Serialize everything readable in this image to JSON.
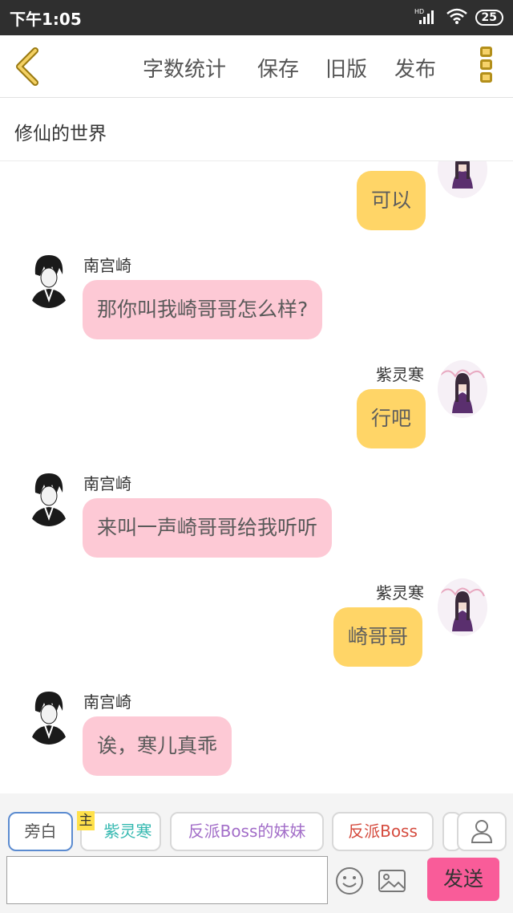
{
  "status_bar": {
    "time": "下午1:05",
    "network": "HD",
    "battery": "25"
  },
  "toolbar": {
    "back_icon": "chevron-left-icon",
    "menu": [
      "字数统计",
      "保存",
      "旧版",
      "发布"
    ],
    "more_icon": "more-vertical-icon",
    "accent_color": "#e9b51d"
  },
  "title": "修仙的世界",
  "messages": [
    {
      "side": "right",
      "speaker": "",
      "text": "可以"
    },
    {
      "side": "left",
      "speaker": "南宫崎",
      "text": "那你叫我崎哥哥怎么样?"
    },
    {
      "side": "right",
      "speaker": "紫灵寒",
      "text": "行吧"
    },
    {
      "side": "left",
      "speaker": "南宫崎",
      "text": "来叫一声崎哥哥给我听听"
    },
    {
      "side": "right",
      "speaker": "紫灵寒",
      "text": "崎哥哥"
    },
    {
      "side": "left",
      "speaker": "南宫崎",
      "text": "诶，寒儿真乖"
    }
  ],
  "roles": [
    {
      "label": "旁白",
      "color": "#555555"
    },
    {
      "label": "紫灵寒",
      "color": "#33b8b0"
    },
    {
      "label": "反派Boss的妹妹",
      "color": "#a26dc8"
    },
    {
      "label": "反派Boss",
      "color": "#d54b3e"
    }
  ],
  "main_badge": "主",
  "input": {
    "value": "",
    "placeholder": ""
  },
  "send_label": "发送",
  "colors": {
    "left_bubble": "#fdc9d5",
    "right_bubble": "#ffd567",
    "send_button": "#f95c99"
  }
}
